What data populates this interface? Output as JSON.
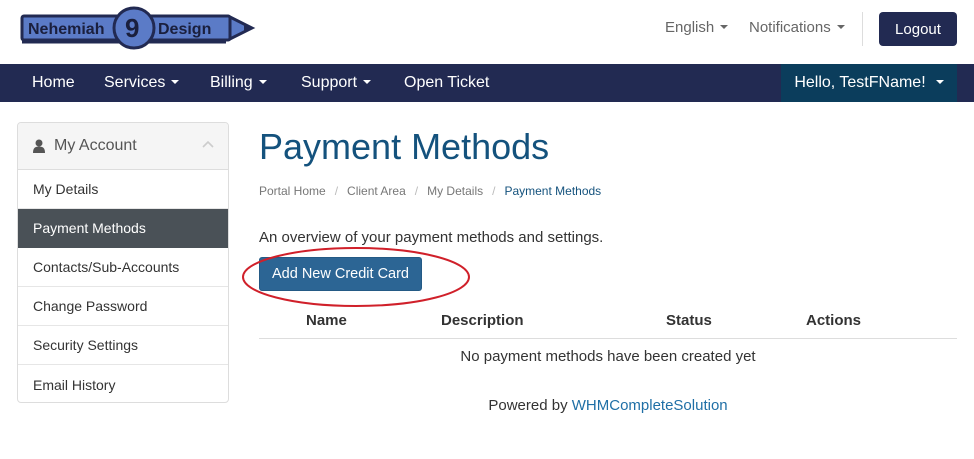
{
  "brand": {
    "logo_part1": "Nehemiah",
    "logo_number": "9",
    "logo_part2": "Design",
    "primary_color": "#222a52",
    "accent_color": "#2c6594",
    "title_color": "#14527d"
  },
  "topbar": {
    "language_label": "English",
    "notifications_label": "Notifications",
    "logout_label": "Logout"
  },
  "nav": {
    "items": [
      {
        "label": "Home"
      },
      {
        "label": "Services"
      },
      {
        "label": "Billing"
      },
      {
        "label": "Support"
      },
      {
        "label": "Open Ticket"
      }
    ],
    "user_greeting": "Hello, TestFName!"
  },
  "sidebar": {
    "title": "My Account",
    "title_icon": "user-icon",
    "items": [
      {
        "label": "My Details"
      },
      {
        "label": "Payment Methods",
        "active": true
      },
      {
        "label": "Contacts/Sub-Accounts"
      },
      {
        "label": "Change Password"
      },
      {
        "label": "Security Settings"
      },
      {
        "label": "Email History"
      }
    ]
  },
  "main": {
    "title": "Payment Methods",
    "breadcrumb": [
      "Portal Home",
      "Client Area",
      "My Details",
      "Payment Methods"
    ],
    "intro": "An overview of your payment methods and settings.",
    "add_button": "Add New Credit Card",
    "table": {
      "headers": [
        "Name",
        "Description",
        "Status",
        "Actions"
      ],
      "empty_message": "No payment methods have been created yet"
    }
  },
  "footer": {
    "powered_prefix": "Powered by",
    "powered_link": "WHMCompleteSolution"
  }
}
